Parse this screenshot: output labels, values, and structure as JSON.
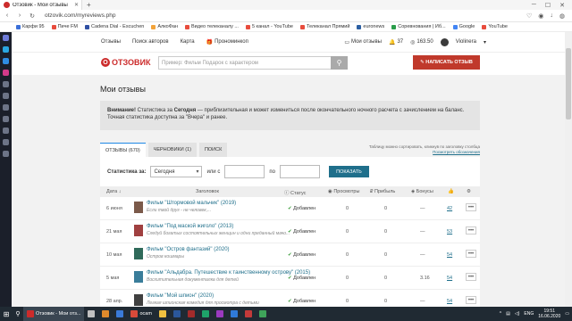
{
  "browser": {
    "tab_title": "Отзовик - Мои отзывы",
    "url": "otzovik.com/myreviews.php",
    "bookmarks": [
      {
        "label": "Карфи 95",
        "color": "#3b6fd8"
      },
      {
        "label": "Пиче FM",
        "color": "#e84c3d"
      },
      {
        "label": "Cadena Dial - Escuchen",
        "color": "#2f4fa3"
      },
      {
        "label": "АлкоФан",
        "color": "#f2a33a"
      },
      {
        "label": "Видео телеканалу ...",
        "color": "#e84c3d"
      },
      {
        "label": "5 канал - YouTube",
        "color": "#e84c3d"
      },
      {
        "label": "Телеканал Прямий",
        "color": "#e84c3d"
      },
      {
        "label": "euronews",
        "color": "#2c5fa3"
      },
      {
        "label": "Соревнования | Иб...",
        "color": "#2a9d4a"
      },
      {
        "label": "Google",
        "color": "#4285f4"
      },
      {
        "label": "YouTube",
        "color": "#e84c3d"
      }
    ]
  },
  "site": {
    "nav": [
      "Отзывы",
      "Поиск авторов",
      "Карта",
      "Прономинкоп"
    ],
    "my_reviews": "Мои отзывы",
    "notif_count": "37",
    "balance": "163.50",
    "username": "Violinera",
    "logo": "ОТЗОВИК",
    "search_placeholder": "Пример: Фильм Подарок с характером",
    "write_button": "НАПИСАТЬ ОТЗЫВ"
  },
  "page": {
    "title": "Мои отзывы",
    "notice_bold": "Внимание!",
    "notice_text": " Статистика за ",
    "notice_bold2": "Сегодня",
    "notice_rest": " — приблизительная и может измениться после окончательного ночного расчета с зачислением на баланс.",
    "notice_line2": "Точная статистика доступна за \"Вчера\" и ранее.",
    "tabs": [
      "ОТЗЫВЫ (670)",
      "ЧЕРНОВИКИ (1)",
      "ПОИСК"
    ],
    "tabs_note_line1": "Таблицу можно сортировать, кликнув по заголовку столбца",
    "tabs_note_line2": "Посмотреть обозначения",
    "filter_label": "Статистика за:",
    "filter_value": "Сегодня",
    "or_from": "или с",
    "to": "по",
    "show_button": "ПОКАЗАТЬ",
    "columns": [
      "Дата",
      "Заголовок",
      "Статус",
      "Просмотры",
      "Прибыль",
      "Бонусы"
    ],
    "rows": [
      {
        "date": "6 июня",
        "title": "Фильм \"Штормовой мальчик\" (2019)",
        "sub": "Если твой друг - не человек,...",
        "status": "Добавлен",
        "views": "0",
        "profit": "0",
        "bonus": "—",
        "count": "42",
        "thumb": "#7b5a4a"
      },
      {
        "date": "21 мая",
        "title": "Фильм \"Под маской жиголо\" (2013)",
        "sub": "Следуй богатых состоятельных женщин и одни преданный мачо...",
        "status": "Добавлен",
        "views": "0",
        "profit": "0",
        "bonus": "—",
        "count": "53",
        "thumb": "#a04040"
      },
      {
        "date": "10 мая",
        "title": "Фильм \"Остров фантазий\" (2020)",
        "sub": "Остров кошмары",
        "status": "Добавлен",
        "views": "0",
        "profit": "0",
        "bonus": "—",
        "count": "54",
        "thumb": "#2f6a5a"
      },
      {
        "date": "5 мая",
        "title": "Фильм \"Альдабра. Путешествие к таинственному острову\" (2015)",
        "sub": "Восхитительная документалка для детей",
        "status": "Добавлен",
        "views": "0",
        "profit": "0",
        "bonus": "3.16",
        "count": "54",
        "thumb": "#3a7d9a"
      },
      {
        "date": "28 апр.",
        "title": "Фильм \"Мой шпион\" (2020)",
        "sub": "Легкая шпионская комедия для просмотра с детьми",
        "status": "Добавлен",
        "views": "0",
        "profit": "0",
        "bonus": "—",
        "count": "54",
        "thumb": "#404040"
      }
    ]
  },
  "taskbar": {
    "apps": [
      {
        "label": "Отзовик - Мои отз...",
        "color": "#cc2b2b",
        "active": true
      },
      {
        "label": "",
        "color": "#c0c0c0",
        "active": false
      },
      {
        "label": "",
        "color": "#e08a2c",
        "active": false
      },
      {
        "label": "",
        "color": "#3a7ad8",
        "active": false
      },
      {
        "label": "ocam",
        "color": "#d94a3a",
        "active": false
      },
      {
        "label": "",
        "color": "#f0c040",
        "active": false
      },
      {
        "label": "",
        "color": "#2b579a",
        "active": false
      },
      {
        "label": "",
        "color": "#a32b2b",
        "active": false
      },
      {
        "label": "",
        "color": "#1ea36a",
        "active": false
      },
      {
        "label": "",
        "color": "#9b3ac0",
        "active": false
      },
      {
        "label": "",
        "color": "#2f7ad9",
        "active": false
      },
      {
        "label": "",
        "color": "#c43a3a",
        "active": false
      },
      {
        "label": "",
        "color": "#3fa35a",
        "active": false
      }
    ],
    "lang": "ENG",
    "time": "19:51",
    "date": "16.06.2020"
  }
}
